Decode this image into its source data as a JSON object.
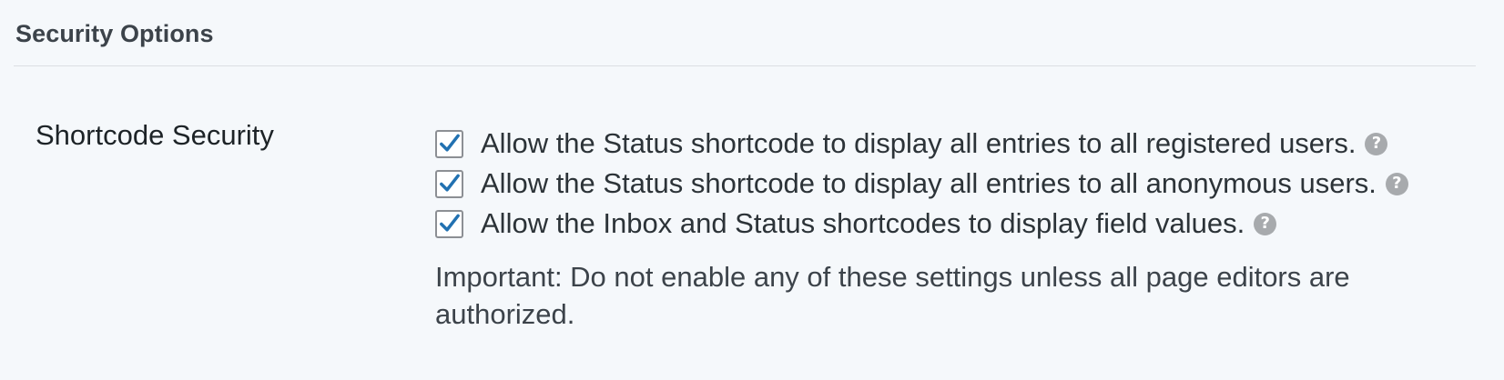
{
  "section": {
    "title": "Security Options"
  },
  "shortcode_security": {
    "label": "Shortcode Security",
    "options": [
      {
        "label": "Allow the Status shortcode to display all entries to all registered users.",
        "checked": true,
        "help_icon": "question-circle-icon"
      },
      {
        "label": "Allow the Status shortcode to display all entries to all anonymous users.",
        "checked": true,
        "help_icon": "question-circle-icon"
      },
      {
        "label": "Allow the Inbox and Status shortcodes to display field values.",
        "checked": true,
        "help_icon": "question-circle-icon"
      }
    ],
    "note": "Important: Do not enable any of these settings unless all page editors are authorized.",
    "help_glyph": "?"
  },
  "colors": {
    "background": "#f5f8fb",
    "checkmark": "#2271b1",
    "help_icon": "#a7aaad",
    "divider": "#dcdfe3"
  }
}
